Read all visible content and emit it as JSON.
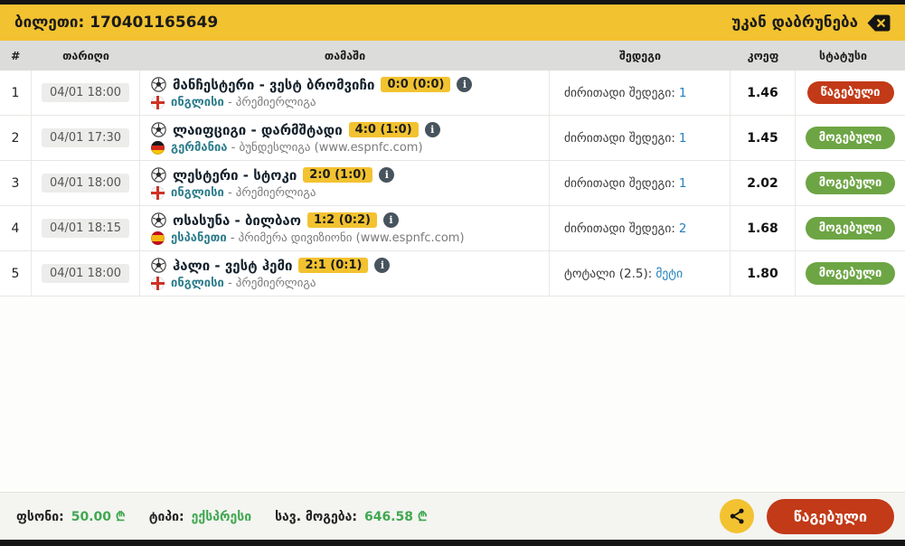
{
  "header": {
    "ticket_title": "ბილეთი: 170401165649",
    "back_label": "უკან დაბრუნება"
  },
  "table": {
    "columns": {
      "num": "#",
      "date": "თარიღი",
      "game": "თამაში",
      "result": "შედეგი",
      "coef": "კოეფ",
      "status": "სტატუსი"
    },
    "rows": [
      {
        "num": "1",
        "date": "04/01 18:00",
        "teams": "მანჩესტერი - ვესტ ბრომვიჩი",
        "score": "0:0 (0:0)",
        "flag": "england",
        "country": "ინგლისი",
        "league": "- პრემიერლიგა",
        "pick_label": "ძირითადი შედეგი:",
        "pick_value": "1",
        "coef": "1.46",
        "status": "წაგებული",
        "status_type": "lost"
      },
      {
        "num": "2",
        "date": "04/01 17:30",
        "teams": "ლაიფციგი - დარმშტადი",
        "score": "4:0 (1:0)",
        "flag": "germany",
        "country": "გერმანია",
        "league": "- ბუნდესლიგა (www.espnfc.com)",
        "pick_label": "ძირითადი შედეგი:",
        "pick_value": "1",
        "coef": "1.45",
        "status": "მოგებული",
        "status_type": "won"
      },
      {
        "num": "3",
        "date": "04/01 18:00",
        "teams": "ლესტერი - სტოკი",
        "score": "2:0 (1:0)",
        "flag": "england",
        "country": "ინგლისი",
        "league": "- პრემიერლიგა",
        "pick_label": "ძირითადი შედეგი:",
        "pick_value": "1",
        "coef": "2.02",
        "status": "მოგებული",
        "status_type": "won"
      },
      {
        "num": "4",
        "date": "04/01 18:15",
        "teams": "ოსასუნა - ბილბაო",
        "score": "1:2 (0:2)",
        "flag": "spain",
        "country": "ესპანეთი",
        "league": "- პრიმერა დივიზიონი (www.espnfc.com)",
        "pick_label": "ძირითადი შედეგი:",
        "pick_value": "2",
        "coef": "1.68",
        "status": "მოგებული",
        "status_type": "won"
      },
      {
        "num": "5",
        "date": "04/01 18:00",
        "teams": "ჰალი - ვესტ ჰემი",
        "score": "2:1 (0:1)",
        "flag": "england",
        "country": "ინგლისი",
        "league": "- პრემიერლიგა",
        "pick_label": "ტოტალი (2.5):",
        "pick_value": "მეტი",
        "coef": "1.80",
        "status": "მოგებული",
        "status_type": "won"
      }
    ]
  },
  "footer": {
    "stake_label": "ფსონი:",
    "stake_value": "50.00",
    "type_label": "ტიპი:",
    "type_value": "ექსპრესი",
    "win_label": "სავ. მოგება:",
    "win_value": "646.58",
    "currency": "₾",
    "result_button": "წაგებული"
  },
  "icons": {
    "back": "backspace-icon",
    "info": "info-icon",
    "ball": "soccer-ball-icon",
    "share": "share-icon"
  },
  "colors": {
    "accent_yellow": "#F2C230",
    "status_lost_red": "#C23A17",
    "status_won_green": "#6DA544",
    "country_teal": "#2E7E8C",
    "pick_blue": "#2381BD",
    "money_green": "#41A851"
  },
  "info_glyph": "i"
}
